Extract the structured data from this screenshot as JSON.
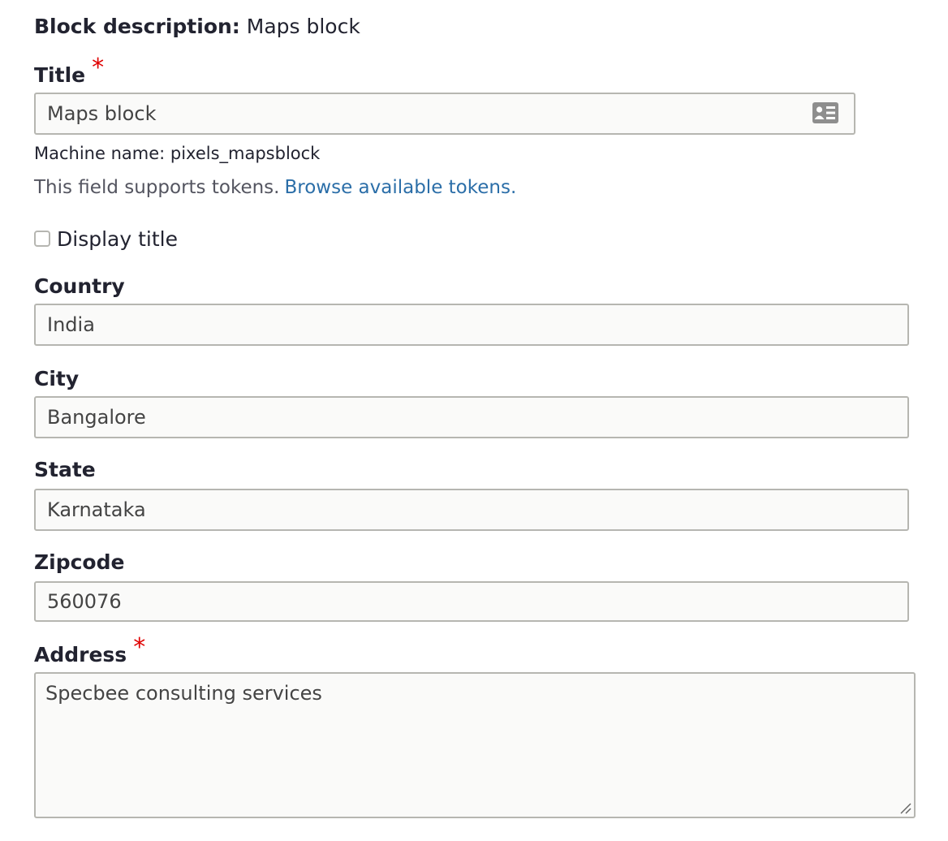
{
  "block_description": {
    "label": "Block description:",
    "value": "Maps block"
  },
  "title_field": {
    "label": "Title",
    "required_marker": "*",
    "value": "Maps block",
    "icon": "contact-card-icon"
  },
  "machine_name": {
    "text": "Machine name: pixels_mapsblock"
  },
  "tokens_help": {
    "text": "This field supports tokens.",
    "link_text": "Browse available tokens."
  },
  "display_title": {
    "label": "Display title",
    "checked": false
  },
  "fields": {
    "country": {
      "label": "Country",
      "value": "India"
    },
    "city": {
      "label": "City",
      "value": "Bangalore"
    },
    "state": {
      "label": "State",
      "value": "Karnataka"
    },
    "zipcode": {
      "label": "Zipcode",
      "value": "560076"
    }
  },
  "address": {
    "label": "Address",
    "required_marker": "*",
    "value": "Specbee consulting services"
  },
  "colors": {
    "required": "#e00000",
    "link": "#2b6ea8",
    "input_border": "#b6b6b1",
    "input_bg": "#fafaf9"
  }
}
